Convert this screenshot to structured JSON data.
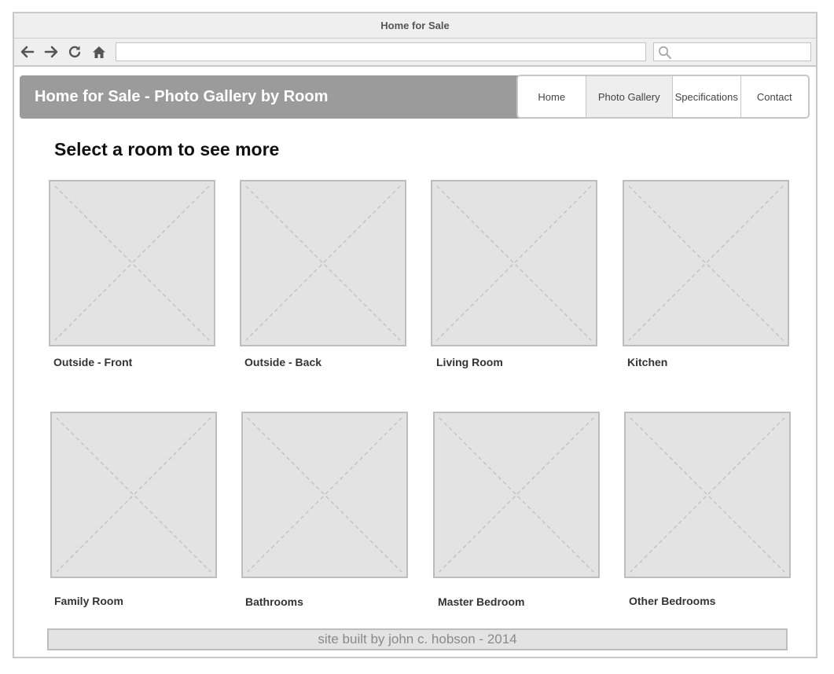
{
  "window": {
    "title": "Home for Sale"
  },
  "browser": {
    "url_value": "",
    "search_value": "",
    "icons": [
      "back-arrow-icon",
      "forward-arrow-icon",
      "reload-icon",
      "home-icon",
      "search-icon"
    ]
  },
  "site": {
    "title": "Home for Sale - Photo Gallery by Room",
    "nav": [
      {
        "label": "Home",
        "active": false
      },
      {
        "label": "Photo Gallery",
        "active": true
      },
      {
        "label": "Specifications",
        "active": false
      },
      {
        "label": "Contact",
        "active": false
      }
    ]
  },
  "main": {
    "heading": "Select a room to see more",
    "rooms": [
      {
        "label": "Outside - Front"
      },
      {
        "label": "Outside - Back"
      },
      {
        "label": "Living Room"
      },
      {
        "label": "Kitchen"
      },
      {
        "label": "Family Room"
      },
      {
        "label": "Bathrooms"
      },
      {
        "label": "Master Bedroom"
      },
      {
        "label": "Other Bedrooms"
      }
    ]
  },
  "footer": {
    "text": "site built by john c. hobson - 2014"
  },
  "colors": {
    "header_bg": "#9b9b9b",
    "placeholder_bg": "#e3e3e3",
    "placeholder_border": "#bdbdbd",
    "active_nav_bg": "#eeeeee"
  }
}
